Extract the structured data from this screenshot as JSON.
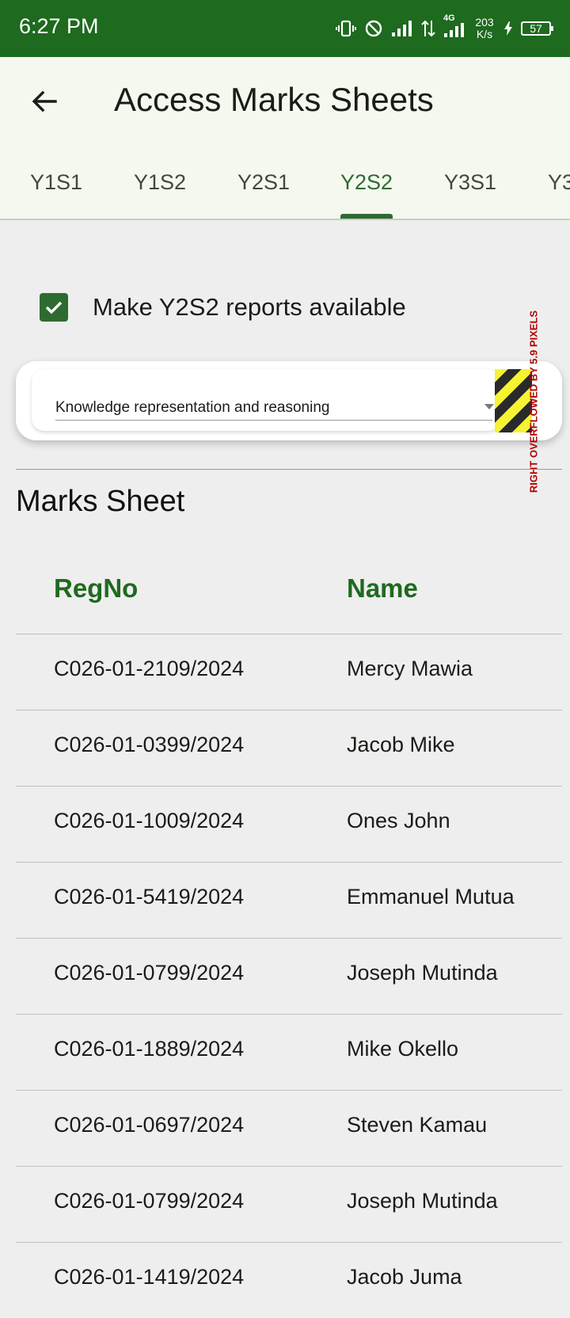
{
  "status_bar": {
    "time": "6:27 PM",
    "net_speed_value": "203",
    "net_speed_unit": "K/s",
    "network_type": "4G",
    "battery": "57"
  },
  "app_bar": {
    "title": "Access Marks Sheets",
    "back_icon": "arrow-back-icon"
  },
  "tabs": [
    {
      "label": "Y1S1",
      "active": false
    },
    {
      "label": "Y1S2",
      "active": false
    },
    {
      "label": "Y2S1",
      "active": false
    },
    {
      "label": "Y2S2",
      "active": true
    },
    {
      "label": "Y3S1",
      "active": false
    },
    {
      "label": "Y3",
      "active": false
    }
  ],
  "availability": {
    "checked": true,
    "label": "Make Y2S2 reports available"
  },
  "unit_dropdown": {
    "selected": "Knowledge representation and reasoning"
  },
  "overflow_warning": "RIGHT OVERFLOWED BY 5.9 PIXELS",
  "marks_sheet": {
    "title": "Marks Sheet",
    "columns": [
      "RegNo",
      "Name"
    ],
    "rows": [
      {
        "reg_no": "C026-01-2109/2024",
        "name": "Mercy Mawia"
      },
      {
        "reg_no": "C026-01-0399/2024",
        "name": "Jacob Mike"
      },
      {
        "reg_no": "C026-01-1009/2024",
        "name": "Ones John"
      },
      {
        "reg_no": "C026-01-5419/2024",
        "name": "Emmanuel Mutua"
      },
      {
        "reg_no": "C026-01-0799/2024",
        "name": "Joseph Mutinda"
      },
      {
        "reg_no": "C026-01-1889/2024",
        "name": "Mike Okello"
      },
      {
        "reg_no": "C026-01-0697/2024",
        "name": "Steven Kamau"
      },
      {
        "reg_no": "C026-01-0799/2024",
        "name": "Joseph Mutinda"
      },
      {
        "reg_no": "C026-01-1419/2024",
        "name": "Jacob Juma"
      }
    ]
  },
  "colors": {
    "primary": "#2e6b30",
    "status_bar": "#1e6a1f",
    "header_text": "#1e6a1f",
    "background": "#eeeeee"
  }
}
